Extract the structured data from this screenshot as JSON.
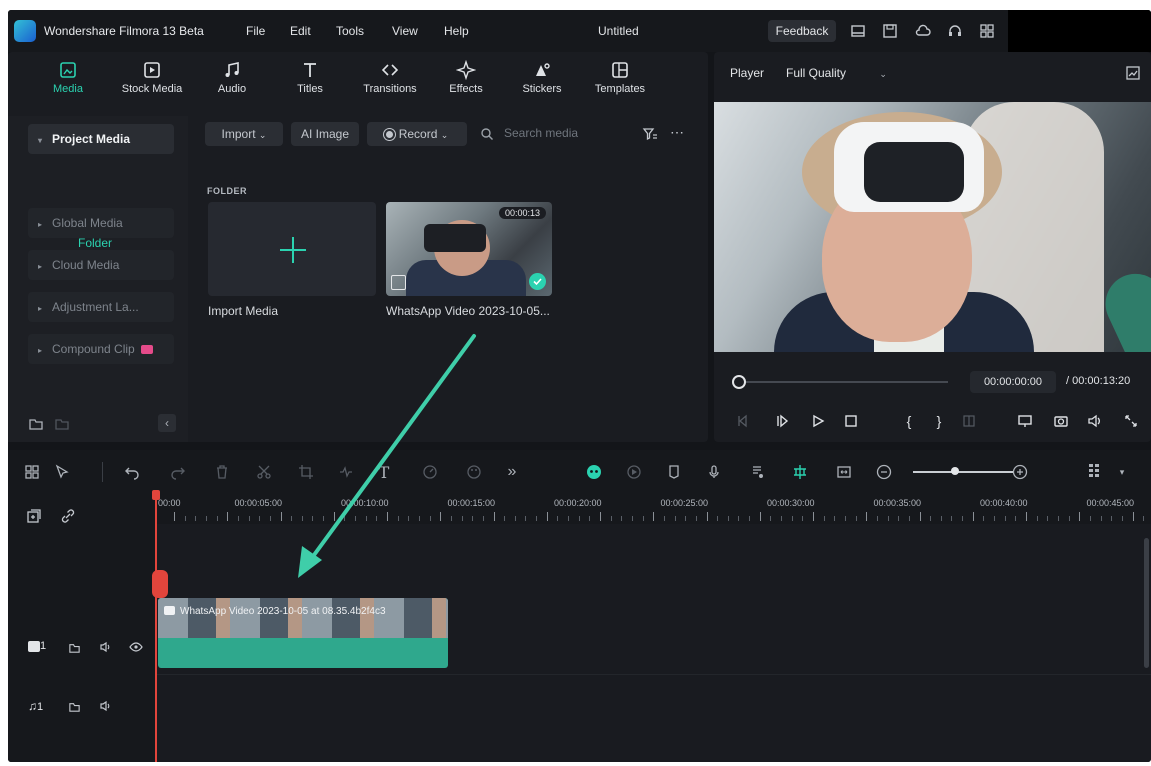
{
  "titlebar": {
    "app_title": "Wondershare Filmora 13 Beta",
    "menu": [
      "File",
      "Edit",
      "Tools",
      "View",
      "Help"
    ],
    "doc_title": "Untitled",
    "feedback": "Feedback"
  },
  "tabs": [
    {
      "label": "Media",
      "icon": "media-icon"
    },
    {
      "label": "Stock Media",
      "icon": "stock-media-icon"
    },
    {
      "label": "Audio",
      "icon": "audio-icon"
    },
    {
      "label": "Titles",
      "icon": "titles-icon"
    },
    {
      "label": "Transitions",
      "icon": "transitions-icon"
    },
    {
      "label": "Effects",
      "icon": "effects-icon"
    },
    {
      "label": "Stickers",
      "icon": "stickers-icon"
    },
    {
      "label": "Templates",
      "icon": "templates-icon"
    }
  ],
  "sidebar": {
    "items": [
      {
        "label": "Project Media"
      },
      {
        "label": "Global Media"
      },
      {
        "label": "Cloud Media"
      },
      {
        "label": "Adjustment La..."
      },
      {
        "label": "Compound Clip"
      }
    ],
    "folder": "Folder"
  },
  "media_toolbar": {
    "import": "Import",
    "ai_image": "AI Image",
    "record": "Record",
    "search_placeholder": "Search media"
  },
  "media": {
    "folder_label": "FOLDER",
    "import_label": "Import Media",
    "video_label": "WhatsApp Video 2023-10-05...",
    "duration": "00:00:13"
  },
  "player": {
    "label": "Player",
    "quality": "Full Quality",
    "current_time": "00:00:00:00",
    "total_time": "/ 00:00:13:20"
  },
  "ruler": {
    "labels": [
      "00:00",
      "00:00:05:00",
      "00:00:10:00",
      "00:00:15:00",
      "00:00:20:00",
      "00:00:25:00",
      "00:00:30:00",
      "00:00:35:00",
      "00:00:40:00",
      "00:00:45:00"
    ]
  },
  "clip": {
    "title": "WhatsApp Video 2023-10-05 at 08.35.4b2f4c3"
  },
  "tracks": {
    "video_index": "1",
    "audio_index": "1"
  },
  "colors": {
    "accent": "#2bd2b0",
    "playhead": "#e2453c",
    "annotation_arrow": "#3fcea9"
  }
}
